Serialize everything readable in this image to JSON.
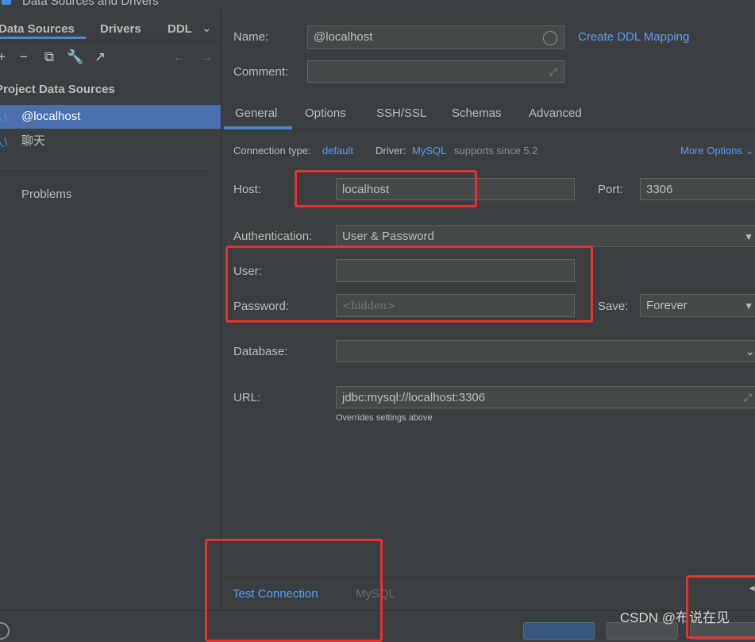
{
  "window": {
    "title": "Data Sources and Drivers"
  },
  "left_tabs": {
    "data_sources": "Data Sources",
    "drivers": "Drivers",
    "ddl": "DDL"
  },
  "tree": {
    "header": "Project Data Sources",
    "items": [
      {
        "label": "@localhost"
      },
      {
        "label": "聊天"
      }
    ],
    "problems": "Problems"
  },
  "form": {
    "name_label": "Name:",
    "name_value": "@localhost",
    "create_ddl_mapping": "Create DDL Mapping",
    "comment_label": "Comment:",
    "comment_value": "",
    "tabs": [
      "General",
      "Options",
      "SSH/SSL",
      "Schemas",
      "Advanced"
    ],
    "connection_type_label": "Connection type:",
    "connection_type_value": "default",
    "driver_label": "Driver:",
    "driver_value": "MySQL",
    "driver_note": "supports since 5.2",
    "more_options": "More Options",
    "host_label": "Host:",
    "host_value": "localhost",
    "port_label": "Port:",
    "port_value": "3306",
    "auth_label": "Authentication:",
    "auth_value": "User & Password",
    "user_label": "User:",
    "user_value": "",
    "password_label": "Password:",
    "password_placeholder": "<hidden>",
    "save_label": "Save:",
    "save_value": "Forever",
    "database_label": "Database:",
    "database_value": "",
    "url_label": "URL:",
    "url_value": "jdbc:mysql://localhost:3306",
    "url_note": "Overrides settings above"
  },
  "bottom": {
    "test_connection": "Test Connection",
    "driver_name": "MySQL"
  },
  "watermark": "CSDN @布说在见",
  "colors": {
    "accent": "#4a88c7",
    "link": "#589df6",
    "selection": "#4b6eaf",
    "highlight_box": "#e8322f"
  }
}
